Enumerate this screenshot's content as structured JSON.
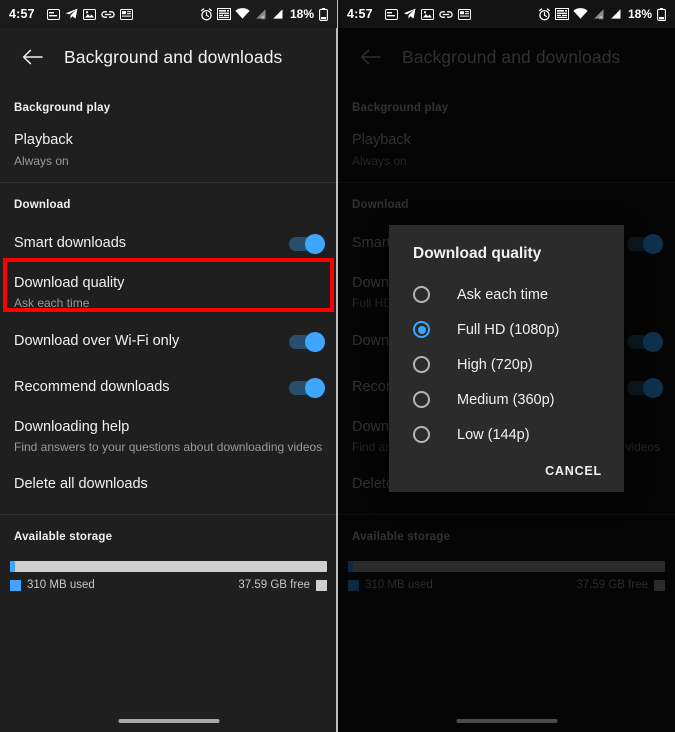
{
  "status_bar": {
    "time": "4:57",
    "battery_percent": "18%",
    "left_icons": [
      "screenshot-icon",
      "telegram-icon",
      "photo-icon",
      "link-icon",
      "news-icon"
    ],
    "right_icons": [
      "alarm-icon",
      "vowifi-icon",
      "wifi-icon",
      "signal-1-icon",
      "signal-2-icon",
      "battery-icon"
    ]
  },
  "app_bar": {
    "back_icon": "arrow-back-icon",
    "title": "Background and downloads"
  },
  "sections": {
    "background_play": {
      "heading": "Background play",
      "playback": {
        "title": "Playback",
        "subtitle": "Always on"
      }
    },
    "download": {
      "heading": "Download",
      "smart_downloads": {
        "title": "Smart downloads",
        "toggle": "on"
      },
      "download_quality": {
        "title": "Download quality",
        "subtitle_before": "Ask each time",
        "subtitle_after": "Full HD"
      },
      "wifi_only": {
        "title": "Download over Wi-Fi only",
        "toggle": "on"
      },
      "recommend": {
        "title": "Recommend downloads",
        "toggle": "on"
      },
      "help": {
        "title": "Downloading help",
        "subtitle": "Find answers to your questions about downloading videos"
      },
      "delete_all": {
        "title": "Delete all downloads"
      }
    },
    "storage": {
      "heading": "Available storage",
      "used_label": "310 MB used",
      "free_label": "37.59 GB free",
      "used_percent": 1.6
    }
  },
  "highlight": {
    "target": "download-quality-row",
    "color": "#fe0000"
  },
  "dialog": {
    "title": "Download quality",
    "options": [
      {
        "label": "Ask each time",
        "selected": false
      },
      {
        "label": "Full HD (1080p)",
        "selected": true
      },
      {
        "label": "High (720p)",
        "selected": false
      },
      {
        "label": "Medium (360p)",
        "selected": false
      },
      {
        "label": "Low (144p)",
        "selected": false
      }
    ],
    "cancel_label": "CANCEL"
  },
  "colors": {
    "accent": "#3ea6ff",
    "background": "#1f1f1f",
    "dialog_bg": "#2b2b2b",
    "highlight": "#fe0000"
  }
}
